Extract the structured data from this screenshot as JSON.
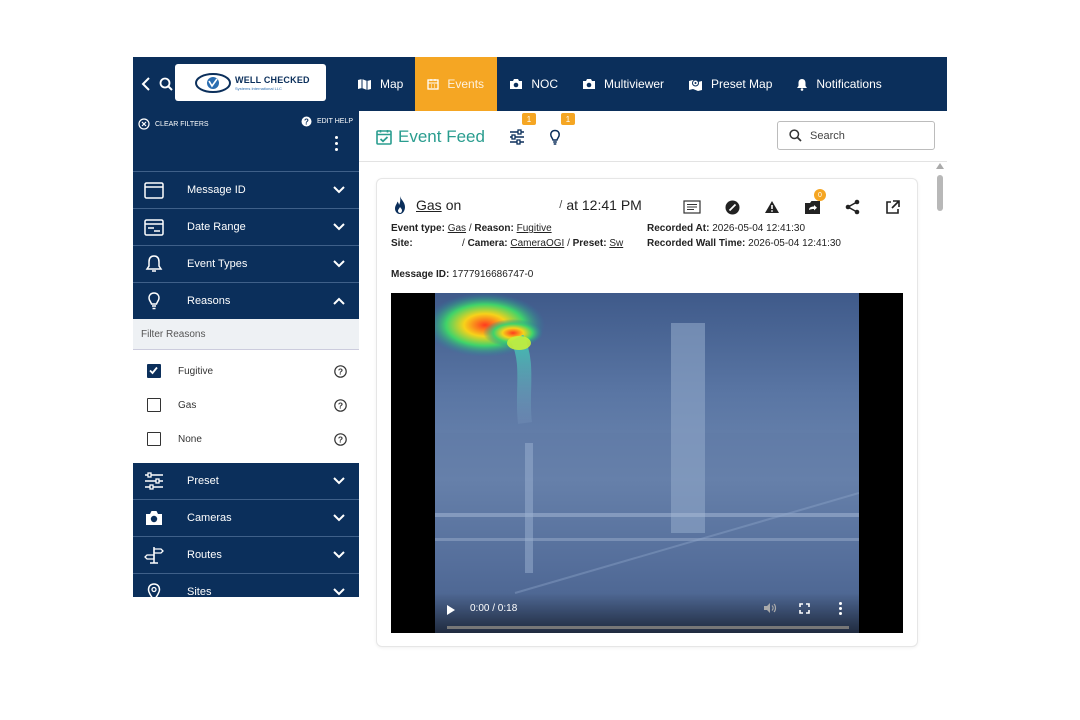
{
  "brand": {
    "logo_title": "WELL CHECKED",
    "logo_sub": "Systems International LLC"
  },
  "nav": {
    "items": [
      {
        "label": "Map",
        "icon": "map-icon"
      },
      {
        "label": "Events",
        "icon": "calendar-icon",
        "active": true
      },
      {
        "label": "NOC",
        "icon": "camera-icon"
      },
      {
        "label": "Multiviewer",
        "icon": "camera-icon"
      },
      {
        "label": "Preset Map",
        "icon": "map-marker-icon"
      },
      {
        "label": "Notifications",
        "icon": "bell-icon"
      }
    ]
  },
  "sidebar": {
    "clear_filters": "CLEAR FILTERS",
    "edit_help": "EDIT HELP",
    "sections": [
      {
        "label": "Message ID",
        "icon": "id-card-icon"
      },
      {
        "label": "Date Range",
        "icon": "calendar-range-icon"
      },
      {
        "label": "Event Types",
        "icon": "bell-icon"
      },
      {
        "label": "Reasons",
        "icon": "lightbulb-icon",
        "expanded": true
      }
    ],
    "reasons": {
      "filter_label": "Filter Reasons",
      "options": [
        {
          "label": "Fugitive",
          "checked": true
        },
        {
          "label": "Gas",
          "checked": false
        },
        {
          "label": "None",
          "checked": false
        }
      ]
    },
    "more_sections": [
      {
        "label": "Preset",
        "icon": "sliders-icon"
      },
      {
        "label": "Cameras",
        "icon": "camera-icon"
      },
      {
        "label": "Routes",
        "icon": "signpost-icon"
      },
      {
        "label": "Sites",
        "icon": "location-pin-icon"
      }
    ]
  },
  "feed": {
    "title": "Event Feed",
    "filter_badge": "1",
    "reasons_badge": "1",
    "search_placeholder": "Search"
  },
  "event": {
    "type_word": "Gas",
    "on_word": "on",
    "slash": "/",
    "time": "at 12:41 PM",
    "share_badge": "0",
    "type_label": "Event type:",
    "type_value": "Gas",
    "reason_label": "Reason:",
    "reason_value": "Fugitive",
    "site_label": "Site:",
    "camera_label": "Camera:",
    "camera_value": "CameraOGI",
    "preset_label": "Preset:",
    "preset_value": "Sw",
    "recorded_at_label": "Recorded At:",
    "recorded_at_value": "2026-05-04 12:41:30",
    "recorded_wall_label": "Recorded Wall Time:",
    "recorded_wall_value": "2026-05-04 12:41:30",
    "message_id_label": "Message ID:",
    "message_id_value": "1777916686747-0"
  },
  "video": {
    "time": "0:00 / 0:18",
    "progress": 0.0
  },
  "colors": {
    "navy": "#0b2f5b",
    "accent": "#f5a623",
    "teal": "#2a9d8f"
  }
}
